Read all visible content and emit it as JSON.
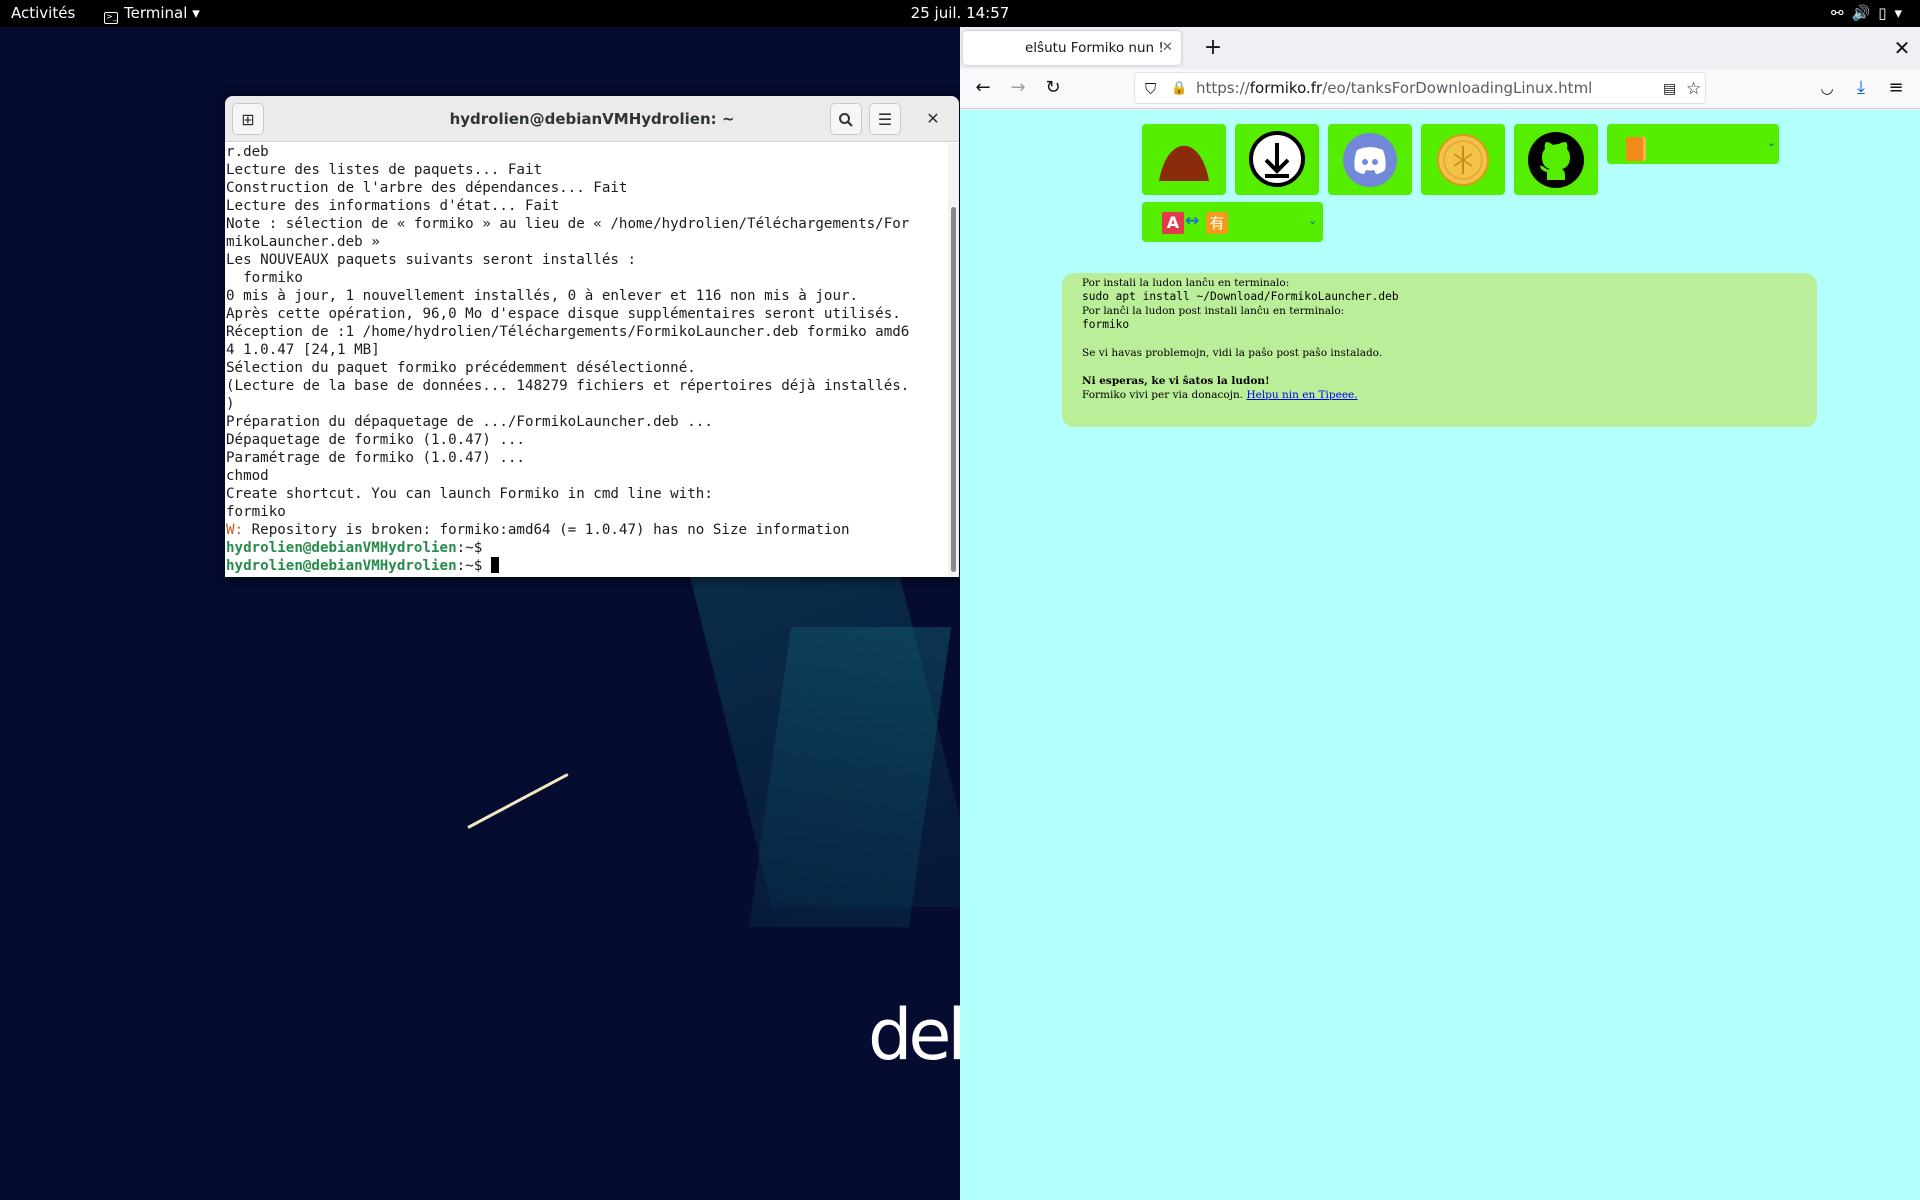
{
  "topbar": {
    "activities": "Activités",
    "app_menu": "Terminal",
    "clock": "25 juil.  14:57"
  },
  "desktop": {
    "logo_text": "deb"
  },
  "terminal": {
    "title": "hydrolien@debianVMHydrolien: ~",
    "lines": [
      "r.deb",
      "Lecture des listes de paquets... Fait",
      "Construction de l'arbre des dépendances... Fait",
      "Lecture des informations d'état... Fait",
      "Note : sélection de « formiko » au lieu de « /home/hydrolien/Téléchargements/For",
      "mikoLauncher.deb »",
      "Les NOUVEAUX paquets suivants seront installés :",
      "  formiko",
      "0 mis à jour, 1 nouvellement installés, 0 à enlever et 116 non mis à jour.",
      "Après cette opération, 96,0 Mo d'espace disque supplémentaires seront utilisés.",
      "Réception de :1 /home/hydrolien/Téléchargements/FormikoLauncher.deb formiko amd6",
      "4 1.0.47 [24,1 MB]",
      "Sélection du paquet formiko précédemment désélectionné.",
      "(Lecture de la base de données... 148279 fichiers et répertoires déjà installés.",
      ")",
      "Préparation du dépaquetage de .../FormikoLauncher.deb ...",
      "Dépaquetage de formiko (1.0.47) ...",
      "Paramétrage de formiko (1.0.47) ...",
      "chmod",
      "Create shortcut. You can launch Formiko in cmd line with:",
      "formiko"
    ],
    "warning_prefix": "W:",
    "warning_text": " Repository is broken: formiko:amd64 (= 1.0.47) has no Size information",
    "prompt_user": "hydrolien@debianVMHydrolien",
    "prompt_suffix": ":~$",
    "prompt_count": 2
  },
  "firefox": {
    "tab_title": "elŝutu Formiko nun !",
    "url_scheme": "https://",
    "url_host": "formiko.fr",
    "url_path": "/eo/tanksForDownloadingLinux.html"
  },
  "page": {
    "line1": "Por instali la ludon lanĉu en terminalo:",
    "command1": "sudo apt install ~/Download/FormikoLauncher.deb",
    "line2": "Por lanĉi la ludon post instali lanĉu en terminalo:",
    "command2": "formiko",
    "problem_text": "Se vi havas problemojn, vidi la paŝo post paŝo instalado.",
    "hope_text": "Ni esperas, ke vi ŝatos la ludon!",
    "donation_text": "Formiko vivi per via donacojn.",
    "donation_link": "Helpu nin en Tipeee.",
    "lang_a": "A",
    "lang_arrow": "↔",
    "lang_han": "有"
  },
  "colors": {
    "page_bg": "#b3fffb",
    "tile_green": "#55ee00",
    "info_box": "#bbee99",
    "prompt_green": "#268c4a"
  }
}
